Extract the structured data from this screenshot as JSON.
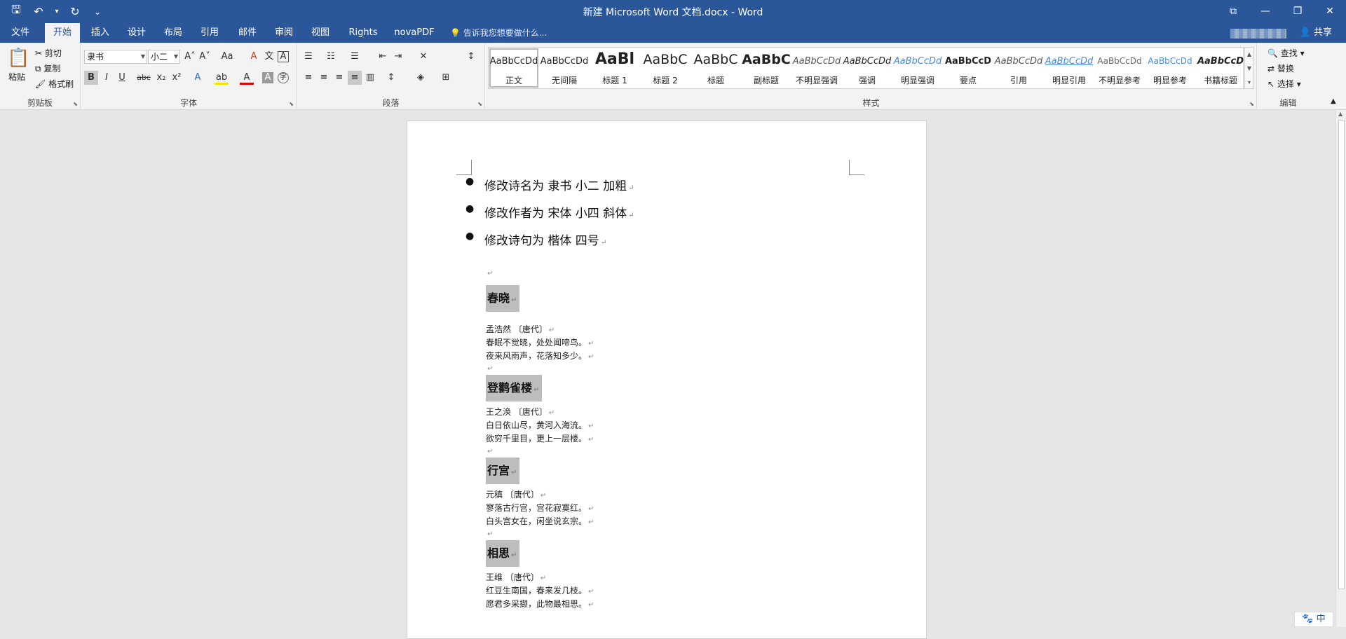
{
  "window": {
    "title": "新建 Microsoft Word 文档.docx - Word",
    "controls": [
      "⧉",
      "—",
      "❐",
      "✕"
    ]
  },
  "qat": {
    "save": "🖫",
    "undo": "↶",
    "undo_dd": "▾",
    "redo": "↻",
    "more": "⌄"
  },
  "tabs": [
    "文件",
    "开始",
    "插入",
    "设计",
    "布局",
    "引用",
    "邮件",
    "审阅",
    "视图",
    "Rights",
    "novaPDF"
  ],
  "active_tab": "开始",
  "tellme": "💡 告诉我您想要做什么...",
  "share": "共享",
  "clipboard": {
    "paste": "粘贴",
    "cut": "剪切",
    "copy": "复制",
    "painter": "格式刷",
    "label": "剪贴板"
  },
  "font": {
    "name": "隶书",
    "size": "小二",
    "label": "字体",
    "grow": "A˄",
    "shrink": "A˅",
    "case": "Aa",
    "clear": "A",
    "phonetic": "文",
    "border": "A",
    "bold": "B",
    "italic": "I",
    "underline": "U",
    "strike": "abc",
    "sub": "x₂",
    "sup": "x²",
    "effect": "A",
    "highlight": "ab",
    "color": "A",
    "shading": "A",
    "enclose": "字"
  },
  "paragraph": {
    "label": "段落"
  },
  "styles": {
    "label": "样式",
    "items": [
      {
        "preview": "AaBbCcDd",
        "name": "正文"
      },
      {
        "preview": "AaBbCcDd",
        "name": "无间隔"
      },
      {
        "preview": "AaBl",
        "name": "标题 1"
      },
      {
        "preview": "AaBbC",
        "name": "标题 2"
      },
      {
        "preview": "AaBbC",
        "name": "标题"
      },
      {
        "preview": "AaBbC",
        "name": "副标题"
      },
      {
        "preview": "AaBbCcDd",
        "name": "不明显强调"
      },
      {
        "preview": "AaBbCcDd",
        "name": "强调"
      },
      {
        "preview": "AaBbCcDd",
        "name": "明显强调"
      },
      {
        "preview": "AaBbCcD",
        "name": "要点"
      },
      {
        "preview": "AaBbCcDd",
        "name": "引用"
      },
      {
        "preview": "AaBbCcDd",
        "name": "明显引用"
      },
      {
        "preview": "AaBbCcDd",
        "name": "不明显参考"
      },
      {
        "preview": "AaBbCcDd",
        "name": "明显参考"
      },
      {
        "preview": "AaBbCcD",
        "name": "书籍标题"
      }
    ]
  },
  "editing": {
    "find": "查找",
    "replace": "替换",
    "select": "选择",
    "label": "编辑"
  },
  "document": {
    "bullets": [
      "修改诗名为 隶书 小二 加粗",
      "修改作者为 宋体 小四 斜体",
      "修改诗句为 楷体 四号"
    ],
    "poems": [
      {
        "title": "春晓",
        "author": "孟浩然 〔唐代〕",
        "lines": [
          "春眠不觉晓，处处闻啼鸟。",
          "夜来风雨声，花落知多少。"
        ]
      },
      {
        "title": "登鹳雀楼",
        "author": "王之涣 〔唐代〕",
        "lines": [
          "白日依山尽，黄河入海流。",
          "欲穷千里目，更上一层楼。"
        ]
      },
      {
        "title": "行宫",
        "author": "元稹 〔唐代〕",
        "lines": [
          "寥落古行宫，宫花寂寞红。",
          "白头宫女在，闲坐说玄宗。"
        ]
      },
      {
        "title": "相思",
        "author": "王维 〔唐代〕",
        "lines": [
          "红豆生南国，春来发几枝。",
          "愿君多采撷，此物最相思。"
        ]
      }
    ],
    "para_mark": "↵"
  },
  "ime": "🐾 中"
}
